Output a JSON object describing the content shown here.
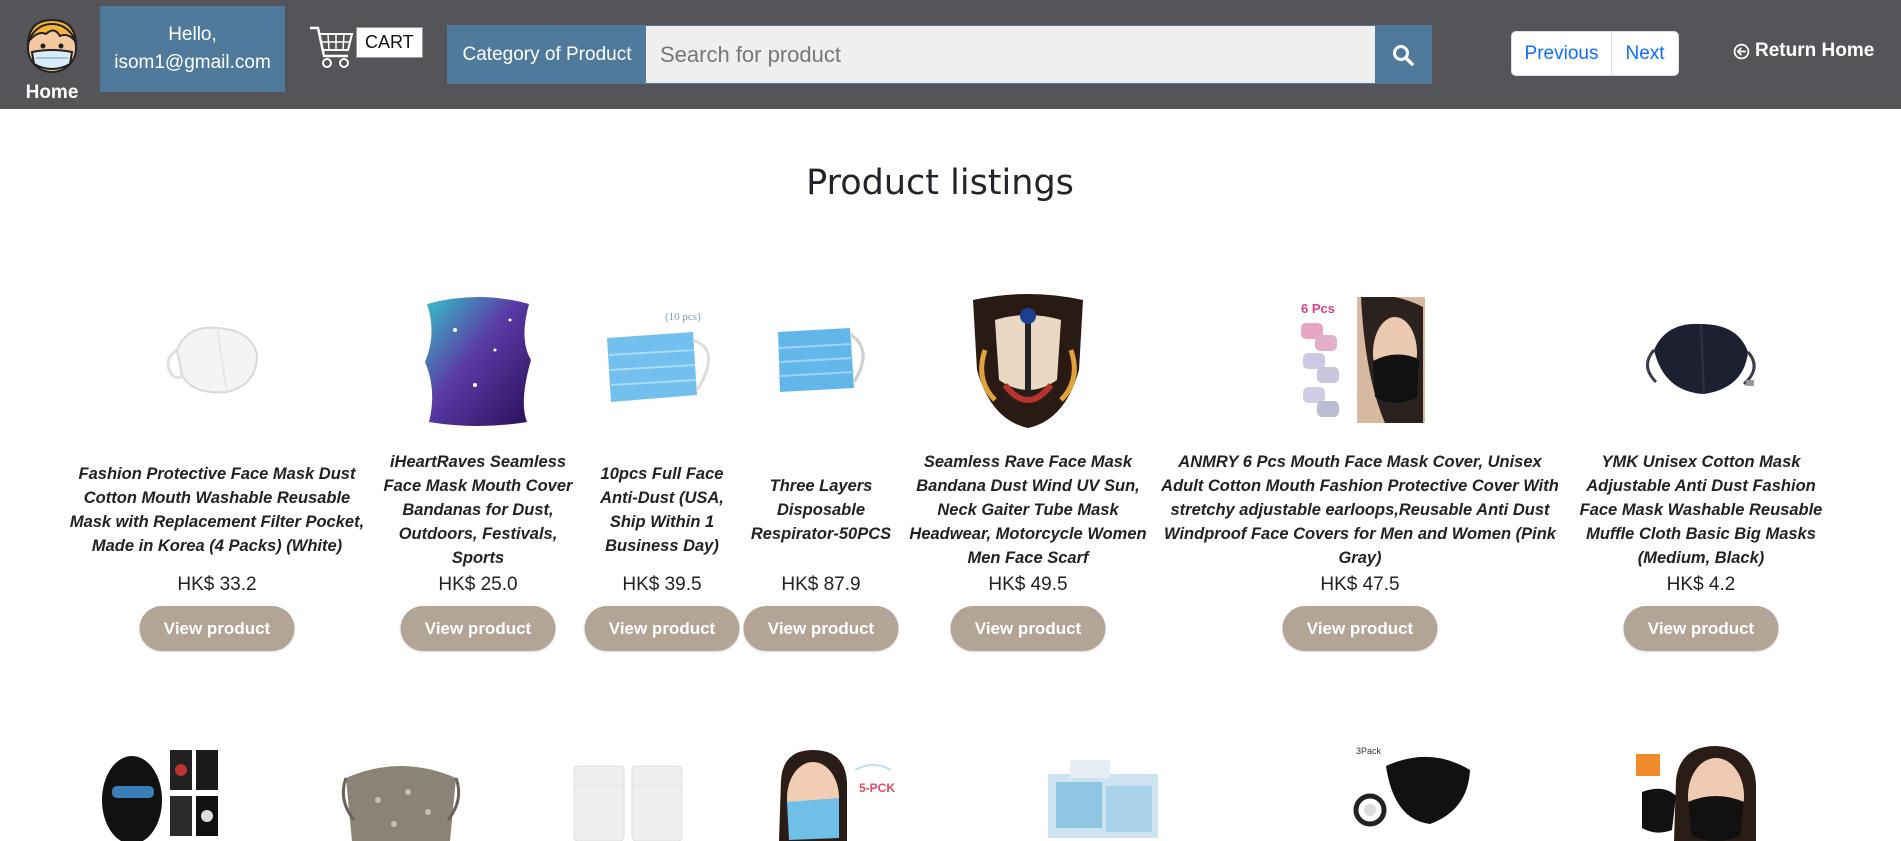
{
  "header": {
    "home_label": "Home",
    "hello_line1": "Hello,",
    "hello_line2": "isom1@gmail.com",
    "cart_label": "CART",
    "category_label": "Category of Product",
    "search_placeholder": "Search for product",
    "prev_label": "Previous",
    "next_label": "Next",
    "return_home_label": "Return Home"
  },
  "main": {
    "title": "Product listings",
    "view_label": "View product",
    "products": [
      {
        "name": "Fashion Protective Face Mask Dust Cotton Mouth Washable Reusable Mask with Replacement Filter Pocket, Made in Korea (4 Packs) (White)",
        "price": "HK$ 33.2"
      },
      {
        "name": "iHeartRaves Seamless Face Mask Mouth Cover Bandanas for Dust, Outdoors, Festivals, Sports",
        "price": "HK$ 25.0"
      },
      {
        "name": "10pcs Full Face Anti-Dust (USA, Ship Within 1 Business Day)",
        "price": "HK$ 39.5"
      },
      {
        "name": "Three Layers Disposable Respirator-50PCS",
        "price": "HK$ 87.9"
      },
      {
        "name": "Seamless Rave Face Mask Bandana Dust Wind UV Sun, Neck Gaiter Tube Mask Headwear, Motorcycle Women Men Face Scarf",
        "price": "HK$ 49.5"
      },
      {
        "name": "ANMRY 6 Pcs Mouth Face Mask Cover, Unisex Adult Cotton Mouth Fashion Protective Cover With stretchy adjustable earloops,Reusable Anti Dust Windproof Face Covers for Men and Women (Pink Gray)",
        "price": "HK$ 47.5"
      },
      {
        "name": "YMK Unisex Cotton Mask Adjustable Anti Dust Fashion Face Mask Washable Reusable Muffle Cloth Basic Big Masks (Medium, Black)",
        "price": "HK$ 4.2"
      }
    ],
    "image_labels": {
      "pack_label": "(10 pcs)",
      "six_pcs": "6 Pcs",
      "three_pack": "3Pack",
      "five_pack": "5-PCK"
    }
  },
  "colors": {
    "topbar": "#555458",
    "accent_blue": "#4f7a9c",
    "button_tan": "#b2a596",
    "link_blue": "#0d6efd"
  }
}
